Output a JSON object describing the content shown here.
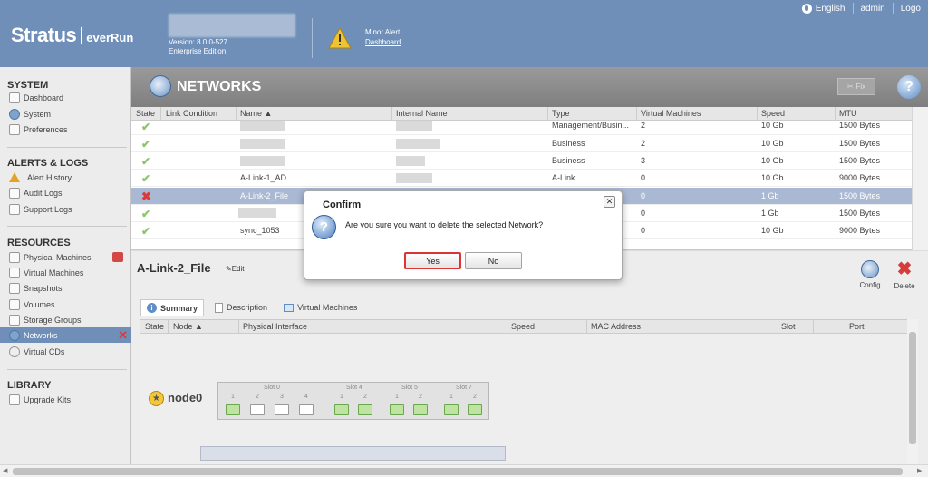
{
  "header": {
    "logo_brand": "Stratus",
    "logo_product": "everRun",
    "version_line1": "Version: 8.0.0-527",
    "version_line2": "Enterprise Edition",
    "alert_title": "Minor Alert",
    "alert_link": "Dashboard",
    "nav": {
      "language": "English",
      "user": "admin",
      "logout": "Logo"
    }
  },
  "sidebar": {
    "system_title": "SYSTEM",
    "system_items": [
      "Dashboard",
      "System",
      "Preferences"
    ],
    "alerts_title": "ALERTS & LOGS",
    "alerts_items": [
      "Alert History",
      "Audit Logs",
      "Support Logs"
    ],
    "resources_title": "RESOURCES",
    "resources_items": [
      "Physical Machines",
      "Virtual Machines",
      "Snapshots",
      "Volumes",
      "Storage Groups",
      "Networks",
      "Virtual CDs"
    ],
    "library_title": "LIBRARY",
    "library_items": [
      "Upgrade Kits"
    ]
  },
  "panel": {
    "title": "NETWORKS",
    "fix_label": "Fix",
    "help_label": "?"
  },
  "table": {
    "headers": [
      "State",
      "Link Condition",
      "Name ▲",
      "Internal Name",
      "Type",
      "Virtual Machines",
      "Speed",
      "MTU"
    ],
    "rows": [
      {
        "state": "ok",
        "name": "",
        "type": "Management/Busin...",
        "vms": "2",
        "speed": "10 Gb",
        "mtu": "1500 Bytes"
      },
      {
        "state": "ok",
        "name": "",
        "type": "Business",
        "vms": "2",
        "speed": "10 Gb",
        "mtu": "1500 Bytes"
      },
      {
        "state": "ok",
        "name": "",
        "type": "Business",
        "vms": "3",
        "speed": "10 Gb",
        "mtu": "1500 Bytes"
      },
      {
        "state": "ok",
        "name": "A-Link-1_AD",
        "type": "A-Link",
        "vms": "0",
        "speed": "10 Gb",
        "mtu": "9000 Bytes"
      },
      {
        "state": "error",
        "name": "A-Link-2_File",
        "type": "",
        "vms": "0",
        "speed": "1 Gb",
        "mtu": "1500 Bytes"
      },
      {
        "state": "ok",
        "name": "",
        "type": "",
        "vms": "0",
        "speed": "1 Gb",
        "mtu": "1500 Bytes"
      },
      {
        "state": "ok",
        "name": "sync_1053",
        "type": "",
        "vms": "0",
        "speed": "10 Gb",
        "mtu": "9000 Bytes"
      }
    ]
  },
  "detail": {
    "title": "A-Link-2_File",
    "edit_label": "Edit",
    "config_label": "Config",
    "delete_label": "Delete",
    "tabs": [
      "Summary",
      "Description",
      "Virtual Machines"
    ],
    "columns": [
      "State",
      "Node ▲",
      "Physical Interface",
      "Speed",
      "MAC Address",
      "Slot",
      "Port"
    ],
    "node_label": "node0",
    "slots": [
      {
        "label": "Slot 0",
        "ports": [
          "1",
          "2",
          "3",
          "4"
        ]
      },
      {
        "label": "Slot 4",
        "ports": [
          "1",
          "2"
        ]
      },
      {
        "label": "Slot 5",
        "ports": [
          "1",
          "2"
        ]
      },
      {
        "label": "Slot 7",
        "ports": [
          "1",
          "2"
        ]
      }
    ]
  },
  "dialog": {
    "title": "Confirm",
    "message": "Are you sure you want to delete the selected Network?",
    "yes": "Yes",
    "no": "No",
    "close": "✕"
  }
}
